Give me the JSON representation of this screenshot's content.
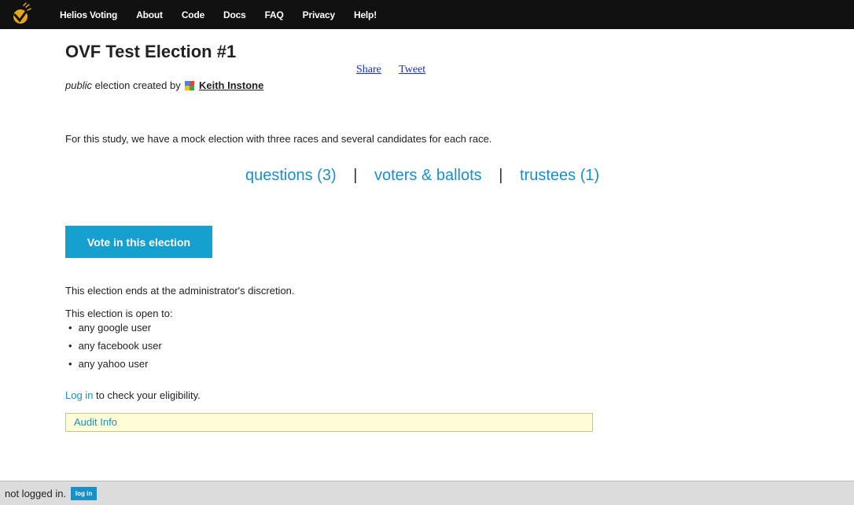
{
  "nav": {
    "brand": "Helios Voting",
    "items": [
      "About",
      "Code",
      "Docs",
      "FAQ",
      "Privacy",
      "Help!"
    ]
  },
  "election": {
    "title": "OVF Test Election #1",
    "visibility": "public",
    "created_by_text": "election created by",
    "creator_name": "Keith Instone",
    "description": "For this study, we have a mock election with three races and several candidates for each race."
  },
  "share": {
    "share_label": "Share",
    "tweet_label": "Tweet"
  },
  "tabs": {
    "questions": "questions (3)",
    "voters": "voters & ballots",
    "trustees": "trustees (1)",
    "separator": "|"
  },
  "vote_button": "Vote in this election",
  "ends_text": "This election ends at the administrator's discretion.",
  "open_to": {
    "heading": "This election is open to:",
    "items": [
      "any google user",
      "any facebook user",
      "any yahoo user"
    ]
  },
  "eligibility": {
    "link": "Log in",
    "text": " to check your eligibility."
  },
  "audit_info": "Audit Info",
  "footer": {
    "status": "not logged in.",
    "login_button": "log in"
  },
  "colors": {
    "accent": "#15a0cf",
    "link": "#1a8fc8",
    "navbar": "#111111",
    "audit_bg": "#fffdd6"
  }
}
